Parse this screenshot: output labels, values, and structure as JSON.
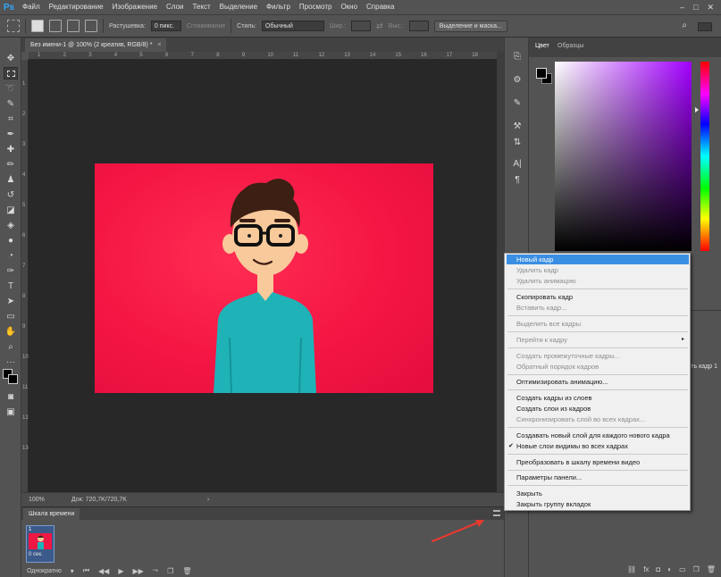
{
  "app": {
    "logo": "Ps",
    "menu": [
      "Файл",
      "Редактирование",
      "Изображение",
      "Слои",
      "Текст",
      "Выделение",
      "Фильтр",
      "Просмотр",
      "Окно",
      "Справка"
    ],
    "window_controls": {
      "minimize": "–",
      "maximize": "□",
      "close": "✕"
    }
  },
  "options_bar": {
    "feather_label": "Растушевка:",
    "feather_value": "0 пикс.",
    "antialias_label": "Сглаживание",
    "style_label": "Стиль:",
    "style_value": "Обычный",
    "width_label": "Шир.:",
    "height_label": "Выс.:",
    "select_mask_button": "Выделение и маска..."
  },
  "document": {
    "tab_title": "Без имени-1 @ 100% (2 креатив, RGB/8) *",
    "close_glyph": "×",
    "ruler_top": [
      "1",
      "2",
      "3",
      "4",
      "5",
      "6",
      "7",
      "8",
      "9",
      "10",
      "11",
      "12",
      "13",
      "14",
      "15",
      "16",
      "17",
      "18"
    ],
    "ruler_left": [
      "1",
      "2",
      "3",
      "4",
      "5",
      "6",
      "7",
      "8",
      "9",
      "10",
      "11",
      "12",
      "13"
    ],
    "canvas_color": "#f41644",
    "character_shirt_color": "#1fb3b8",
    "character_hair_color": "#3d1f14"
  },
  "status_bar": {
    "zoom": "100%",
    "doc_info": "Док: 720,7K/720,7K",
    "arrow": "›"
  },
  "timeline": {
    "title": "Шкала времени",
    "frame_number": "1",
    "frame_delay": "0 сек.",
    "loop_option": "Однократно"
  },
  "color_panel": {
    "tab_color": "Цвет",
    "tab_swatches": "Образцы"
  },
  "layers_panel": {
    "propagate_label": "тить кадр 1"
  },
  "context_menu": {
    "items": [
      {
        "label": "Новый кадр",
        "state": "highlight"
      },
      {
        "label": "Удалить кадр",
        "state": "disabled"
      },
      {
        "label": "Удалить анимацию",
        "state": "disabled"
      },
      {
        "label": "Скопировать кадр",
        "state": "enabled"
      },
      {
        "label": "Вставить кадр...",
        "state": "disabled"
      },
      {
        "label": "Выделить все кадры",
        "state": "disabled"
      },
      {
        "label": "Перейти к кадру",
        "state": "disabled",
        "submenu": "▸"
      },
      {
        "label": "Создать промежуточные кадры...",
        "state": "disabled"
      },
      {
        "label": "Обратный порядок кадров",
        "state": "disabled"
      },
      {
        "label": "Оптимизировать анимацию...",
        "state": "enabled"
      },
      {
        "label": "Создать кадры из слоев",
        "state": "enabled"
      },
      {
        "label": "Создать слои из кадров",
        "state": "enabled"
      },
      {
        "label": "Синхронизировать слой во всех кадрах...",
        "state": "disabled"
      },
      {
        "label": "Создавать новый слой для каждого нового кадра",
        "state": "enabled"
      },
      {
        "label": "Новые слои видимы во всех кадрах",
        "state": "checked",
        "check": "✔"
      },
      {
        "label": "Преобразовать в шкалу времени видео",
        "state": "enabled"
      },
      {
        "label": "Параметры панели...",
        "state": "enabled"
      },
      {
        "label": "Закрыть",
        "state": "enabled"
      },
      {
        "label": "Закрыть группу вкладок",
        "state": "enabled"
      }
    ]
  },
  "colors": {
    "highlight": "#3b8fe3",
    "annotation_arrow": "#e53a2e"
  }
}
